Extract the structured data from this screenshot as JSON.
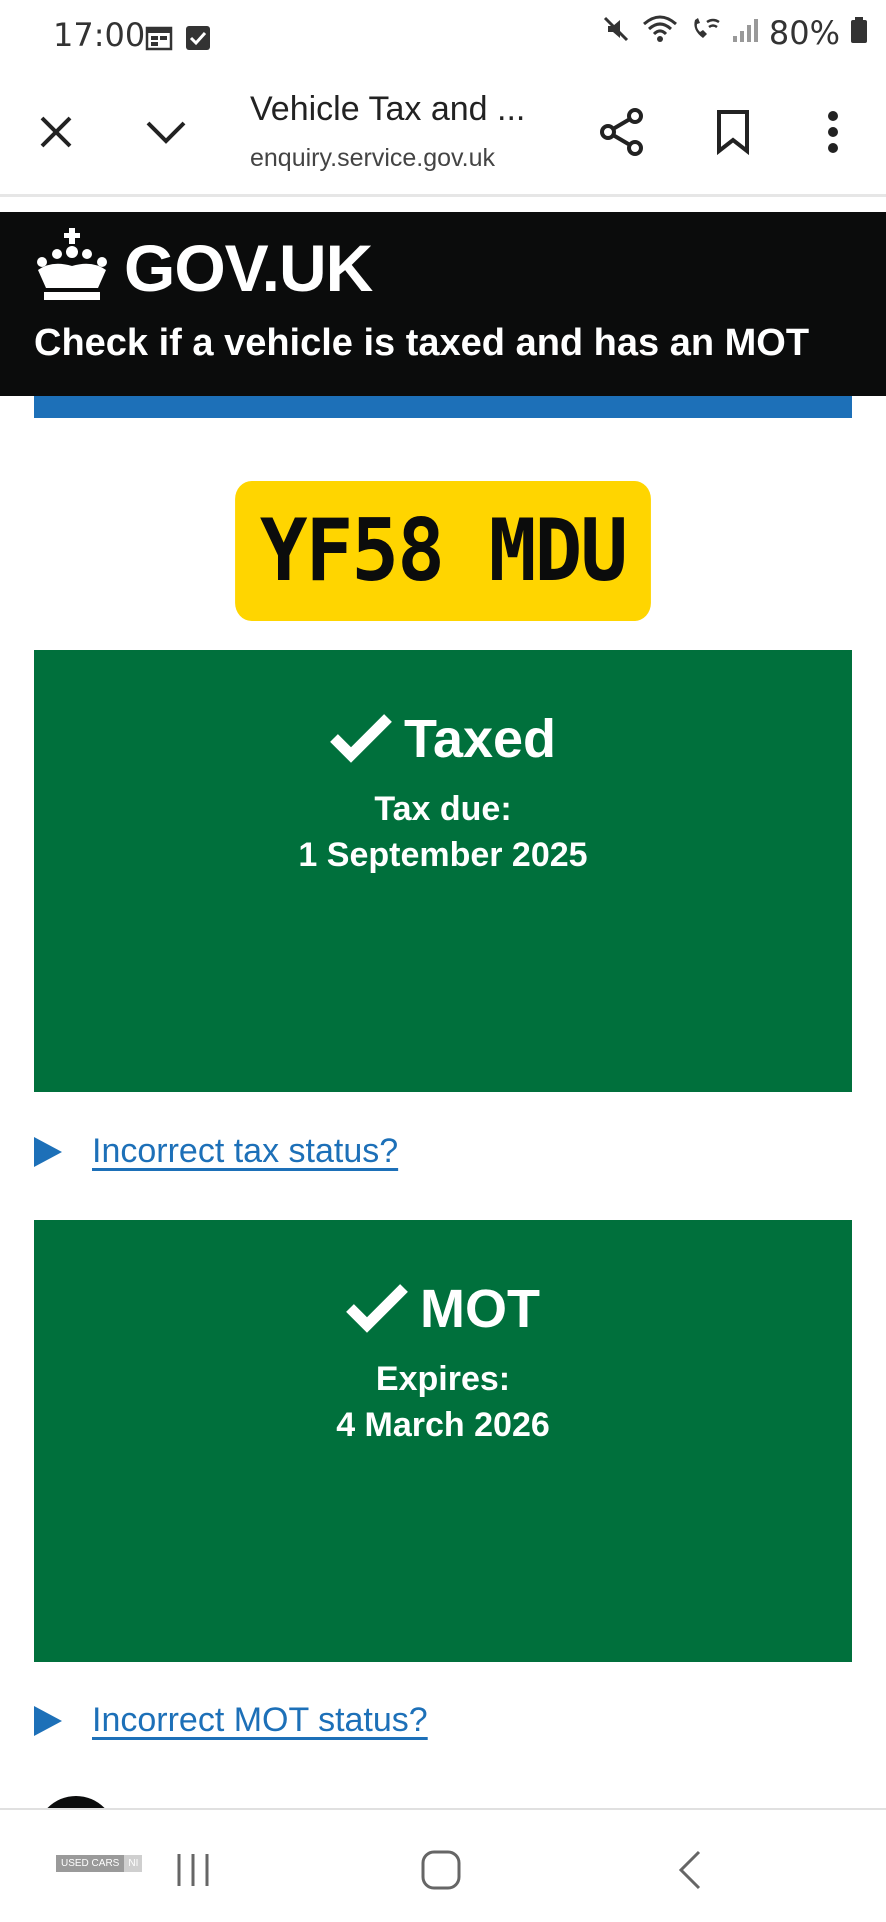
{
  "status_bar": {
    "time": "17:00",
    "battery": "80%",
    "icons": [
      "calendar-icon",
      "checkbox-icon",
      "mute-icon",
      "wifi-icon",
      "wifi-call-icon",
      "signal-icon",
      "battery-icon"
    ]
  },
  "browser": {
    "title": "Vehicle Tax and ...",
    "url": "enquiry.service.gov.uk",
    "icons": [
      "close-icon",
      "chevron-down-icon",
      "share-icon",
      "bookmark-icon",
      "more-icon"
    ]
  },
  "gov_header": {
    "logo": "GOV.UK",
    "service_name": "Check if a vehicle is taxed and has an MOT"
  },
  "vehicle": {
    "registration": "YF58 MDU"
  },
  "tax_panel": {
    "title": "Taxed",
    "label": "Tax due:",
    "date": "1 September 2025",
    "details_link": "Incorrect tax status?"
  },
  "mot_panel": {
    "title": "MOT",
    "label": "Expires:",
    "date": "4 March 2026",
    "details_link": "Incorrect MOT status?"
  },
  "nav_bar": {
    "badge_text": "USED CARS",
    "badge_suffix": "NI",
    "icons": [
      "recent-apps-icon",
      "home-icon",
      "back-icon"
    ]
  },
  "colors": {
    "header_black": "#0b0c0c",
    "gov_blue": "#1d70b8",
    "success_green": "#00703c",
    "plate_yellow": "#ffd500"
  }
}
